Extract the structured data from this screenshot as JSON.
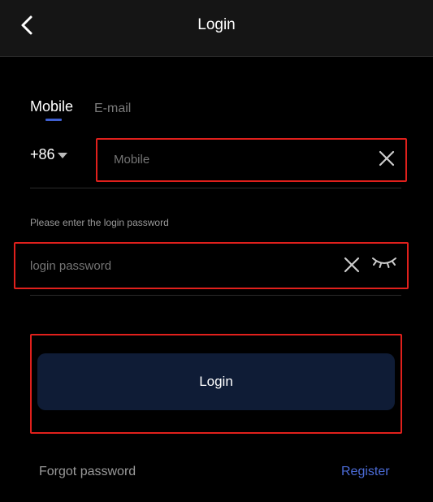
{
  "header": {
    "title": "Login",
    "back_icon": "chevron-left-icon"
  },
  "tabs": [
    {
      "label": "Mobile",
      "active": true
    },
    {
      "label": "E-mail",
      "active": false
    }
  ],
  "phone": {
    "country_code": "+86",
    "placeholder": "Mobile",
    "value": ""
  },
  "password": {
    "hint": "Please enter the login password",
    "placeholder": "login password",
    "value": ""
  },
  "actions": {
    "login_label": "Login",
    "forgot_label": "Forgot password",
    "register_label": "Register"
  },
  "colors": {
    "background": "#000000",
    "header_bg": "#151515",
    "accent": "#4b6bd6",
    "tab_indicator": "#3f5fd0",
    "login_button_bg": "#0f1c36",
    "highlight_border": "#e0201c",
    "muted_text": "#9a9a9a"
  }
}
